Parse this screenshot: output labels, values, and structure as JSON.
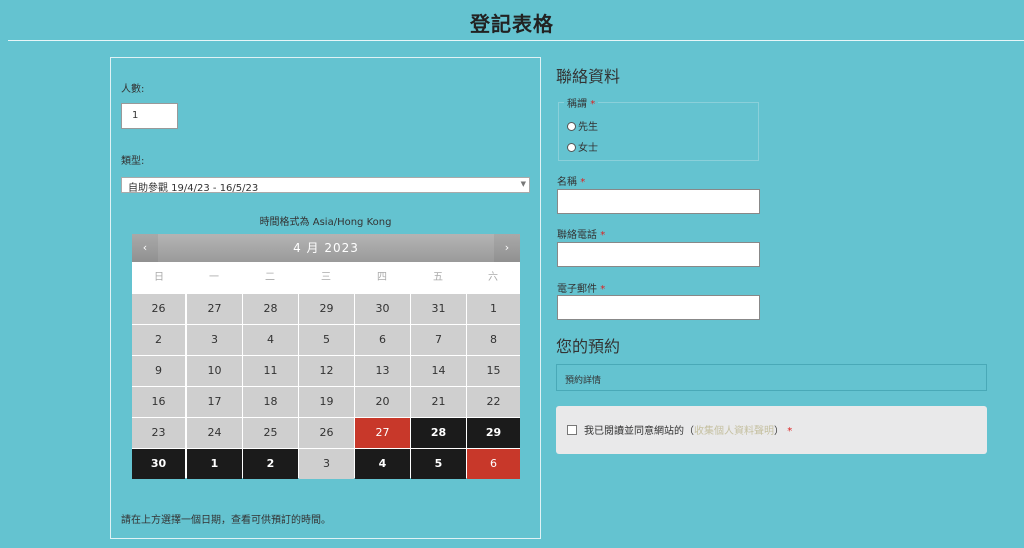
{
  "header": {
    "title": "登記表格"
  },
  "booking_form": {
    "people_label": "人數:",
    "people_value": "1",
    "type_label": "類型:",
    "type_selected": "自助參觀 19/4/23 - 16/5/23",
    "timezone_note": "時間格式為 Asia/Hong Kong",
    "hint": "請在上方選擇一個日期，查看可供預訂的時間。"
  },
  "calendar": {
    "prev_label": "‹",
    "next_label": "›",
    "month_label": "4 月 2023",
    "weekdays": [
      "日",
      "一",
      "二",
      "三",
      "四",
      "五",
      "六"
    ],
    "weeks": [
      [
        {
          "d": "26",
          "s": "gray"
        },
        {
          "d": "27",
          "s": "gray"
        },
        {
          "d": "28",
          "s": "gray"
        },
        {
          "d": "29",
          "s": "gray"
        },
        {
          "d": "30",
          "s": "gray"
        },
        {
          "d": "31",
          "s": "gray"
        },
        {
          "d": "1",
          "s": "gray"
        }
      ],
      [
        {
          "d": "2",
          "s": "gray"
        },
        {
          "d": "3",
          "s": "gray"
        },
        {
          "d": "4",
          "s": "gray"
        },
        {
          "d": "5",
          "s": "gray"
        },
        {
          "d": "6",
          "s": "gray"
        },
        {
          "d": "7",
          "s": "gray"
        },
        {
          "d": "8",
          "s": "gray"
        }
      ],
      [
        {
          "d": "9",
          "s": "gray"
        },
        {
          "d": "10",
          "s": "gray"
        },
        {
          "d": "11",
          "s": "gray"
        },
        {
          "d": "12",
          "s": "gray"
        },
        {
          "d": "13",
          "s": "gray"
        },
        {
          "d": "14",
          "s": "gray"
        },
        {
          "d": "15",
          "s": "gray"
        }
      ],
      [
        {
          "d": "16",
          "s": "gray"
        },
        {
          "d": "17",
          "s": "gray"
        },
        {
          "d": "18",
          "s": "gray"
        },
        {
          "d": "19",
          "s": "gray"
        },
        {
          "d": "20",
          "s": "gray"
        },
        {
          "d": "21",
          "s": "gray"
        },
        {
          "d": "22",
          "s": "gray"
        }
      ],
      [
        {
          "d": "23",
          "s": "gray"
        },
        {
          "d": "24",
          "s": "gray"
        },
        {
          "d": "25",
          "s": "gray"
        },
        {
          "d": "26",
          "s": "gray"
        },
        {
          "d": "27",
          "s": "red"
        },
        {
          "d": "28",
          "s": "black"
        },
        {
          "d": "29",
          "s": "black"
        }
      ],
      [
        {
          "d": "30",
          "s": "black"
        },
        {
          "d": "1",
          "s": "black"
        },
        {
          "d": "2",
          "s": "black"
        },
        {
          "d": "3",
          "s": "gray"
        },
        {
          "d": "4",
          "s": "black"
        },
        {
          "d": "5",
          "s": "black"
        },
        {
          "d": "6",
          "s": "red"
        }
      ]
    ],
    "colors": {
      "unavailable": "#cfcfcf",
      "available": "#1b1b1b",
      "highlight": "#c8382a",
      "header": "#a5a5a5"
    }
  },
  "contact": {
    "section_title": "聯絡資料",
    "title_label": "稱謂",
    "title_options": [
      "先生",
      "女士"
    ],
    "name_label": "名稱",
    "phone_label": "聯絡電話",
    "email_label": "電子郵件",
    "required_mark": "*"
  },
  "booking": {
    "section_title": "您的預約",
    "details_label": "預約詳情"
  },
  "consent": {
    "text": "我已閱讀並同意網站的（",
    "link": "收集個人資料聲明",
    "close": "）",
    "required_mark": "*"
  },
  "colors": {
    "background": "#64c3d0",
    "required": "#d22222"
  }
}
